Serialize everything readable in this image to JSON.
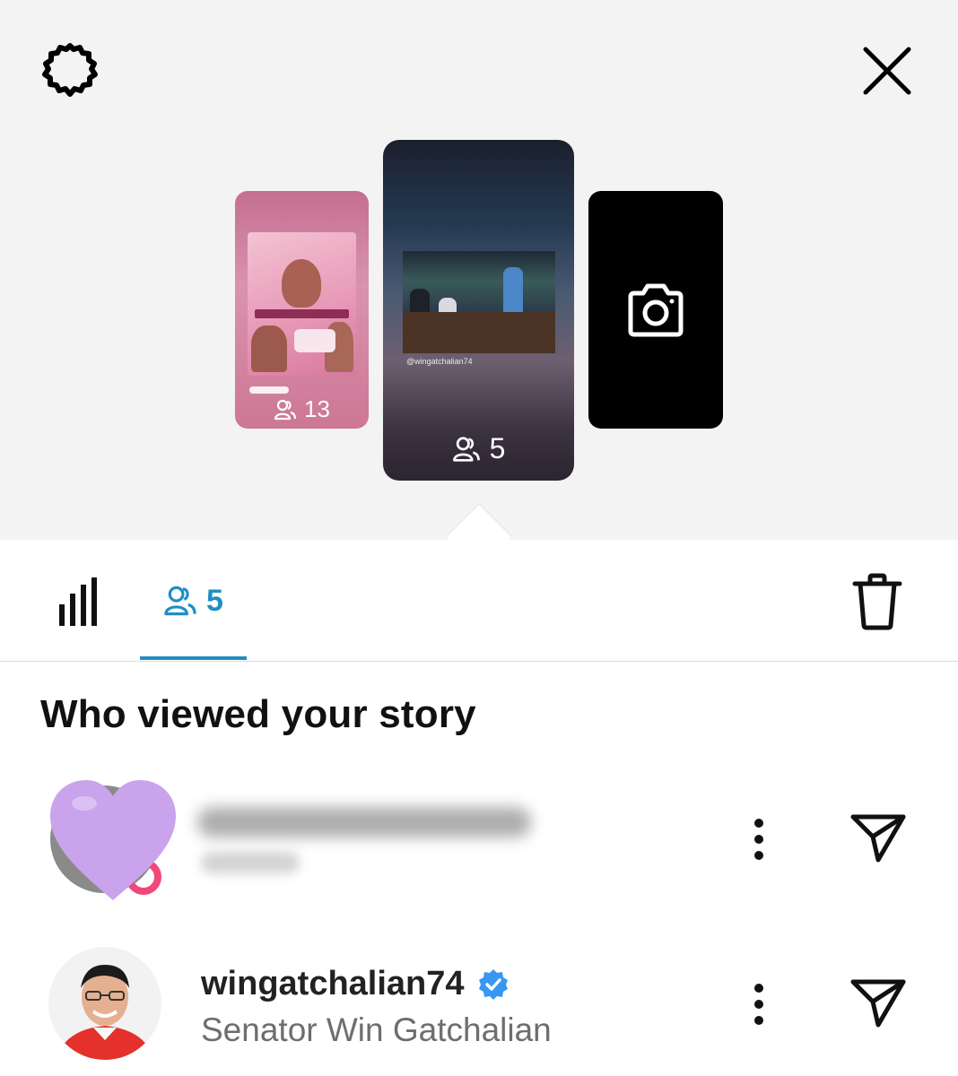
{
  "header": {
    "settings_icon": "settings-gear-icon",
    "close_icon": "close-x-icon"
  },
  "stories": [
    {
      "viewer_count": "13",
      "kind": "image-poster"
    },
    {
      "viewer_count": "5",
      "kind": "video-share",
      "handle": "@wingatchalian74",
      "selected": true
    },
    {
      "kind": "add-story",
      "icon": "camera-icon"
    }
  ],
  "tabs": {
    "insights_icon": "bar-chart-icon",
    "viewers_count": "5",
    "active_color": "#1e8fc4"
  },
  "viewers_section": {
    "title": "Who viewed your story",
    "viewers": [
      {
        "username": "",
        "full_name": "",
        "blurred": true,
        "avatar": "heart-avatar"
      },
      {
        "username": "wingatchalian74",
        "verified": true,
        "full_name": "Senator Win Gatchalian",
        "avatar": "portrait-avatar"
      }
    ]
  },
  "colors": {
    "background_top": "#f3f3f3",
    "accent": "#1e8fc4",
    "verified_badge": "#3897f0",
    "heart": "#c9a4ec"
  }
}
